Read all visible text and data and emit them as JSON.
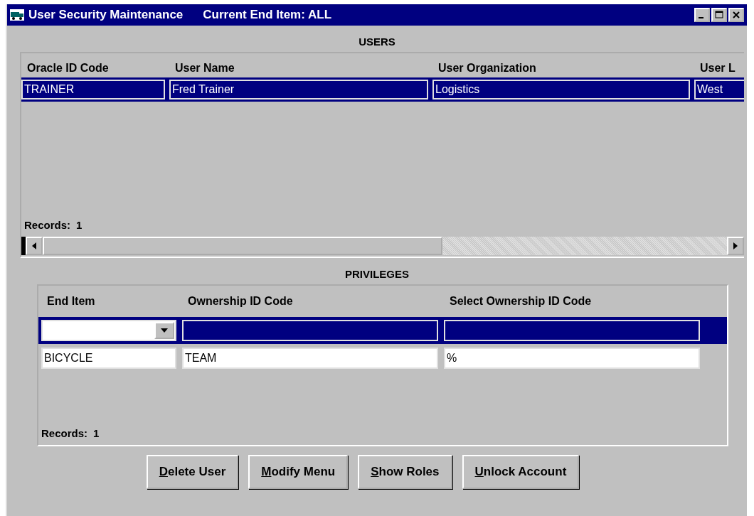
{
  "window": {
    "title": "User Security Maintenance",
    "subtitle": "Current End Item: ALL"
  },
  "users": {
    "heading": "USERS",
    "columns": [
      "Oracle ID Code",
      "User Name",
      "User Organization",
      "User L"
    ],
    "rows": [
      {
        "selected": true,
        "cells": [
          "TRAINER",
          "Fred Trainer",
          "Logistics",
          "West"
        ]
      }
    ],
    "records_label": "Records:",
    "records_count": "1"
  },
  "privileges": {
    "heading": "PRIVILEGES",
    "columns": [
      "End Item",
      "Ownership ID Code",
      "Select Ownership ID Code"
    ],
    "rows": [
      {
        "kind": "entry",
        "selected": true
      },
      {
        "kind": "record",
        "selected": false,
        "cells": [
          "BICYCLE",
          "TEAM",
          "%"
        ]
      }
    ],
    "records_label": "Records:",
    "records_count": "1"
  },
  "buttons": [
    {
      "label": "Delete User",
      "mnemonic_first": true
    },
    {
      "label": "Modify Menu",
      "mnemonic_first": true
    },
    {
      "label": "Show Roles",
      "mnemonic_first": true
    },
    {
      "label": "Unlock Account",
      "mnemonic_first": true
    }
  ]
}
